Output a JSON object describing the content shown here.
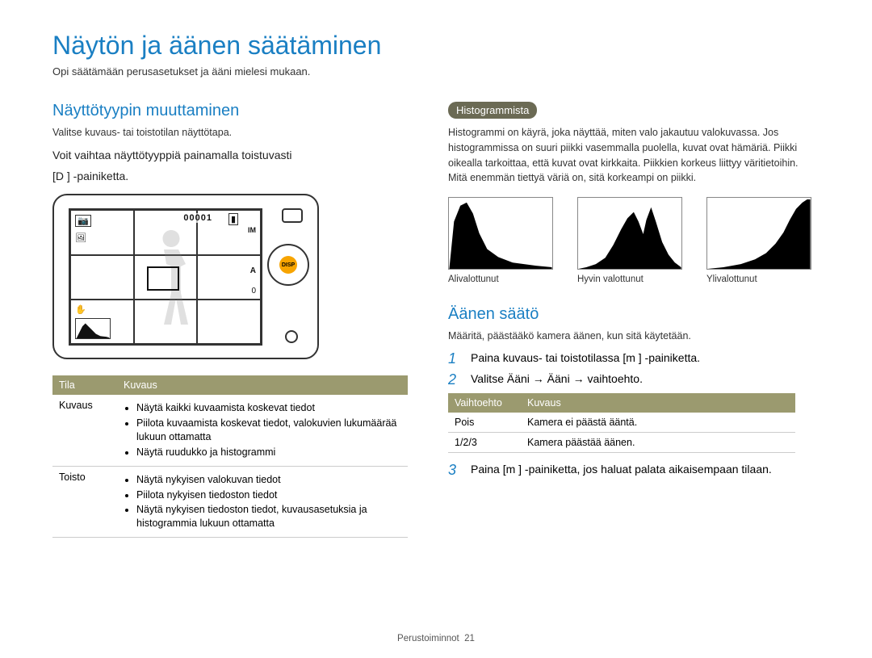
{
  "page_title": "Näytön ja äänen säätäminen",
  "page_subtitle": "Opi säätämään perusasetukset ja ääni mielesi mukaan.",
  "left": {
    "heading": "Näyttötyypin muuttaminen",
    "note": "Valitse kuvaus- tai toistotilan näyttötapa.",
    "body_line1": "Voit vaihtaa näyttötyyppiä painamalla toistuvasti",
    "body_line2": "[D   ] -painiketta.",
    "camera": {
      "counter": "00001",
      "disp": "DISP",
      "icons": {
        "topLeft": "📷",
        "indicator1": "IM",
        "indicator2": "A",
        "indicator3": "0"
      }
    },
    "table": {
      "headers": [
        "Tila",
        "Kuvaus"
      ],
      "rows": [
        {
          "mode": "Kuvaus",
          "items": [
            "Näytä kaikki kuvaamista koskevat tiedot",
            "Piilota kuvaamista koskevat tiedot, valokuvien lukumäärää lukuun ottamatta",
            "Näytä ruudukko ja histogrammi"
          ]
        },
        {
          "mode": "Toisto",
          "items": [
            "Näytä nykyisen valokuvan tiedot",
            "Piilota nykyisen tiedoston tiedot",
            "Näytä nykyisen tiedoston tiedot, kuvausasetuksia ja histogrammia lukuun ottamatta"
          ]
        }
      ]
    }
  },
  "right": {
    "tag": "Histogrammista",
    "hist_text": "Histogrammi on käyrä, joka näyttää, miten valo jakautuu valokuvassa. Jos histogrammissa on suuri piikki vasemmalla puolella, kuvat ovat hämäriä. Piikki oikealla tarkoittaa, että kuvat ovat kirkkaita. Piikkien korkeus liittyy väritietoihin. Mitä enemmän tiettyä väriä on, sitä korkeampi on piikki.",
    "hist_labels": [
      "Alivalottunut",
      "Hyvin valottunut",
      "Ylivalottunut"
    ],
    "sound_heading": "Äänen säätö",
    "sound_note": "Määritä, päästääkö kamera äänen, kun sitä käytetään.",
    "steps": [
      "Paina kuvaus- tai toistotilassa [m   ] -painiketta.",
      "Valitse Ääni → Ääni → vaihtoehto."
    ],
    "opt_table": {
      "headers": [
        "Vaihtoehto",
        "Kuvaus"
      ],
      "rows": [
        {
          "opt": "Pois",
          "desc": "Kamera ei päästä ääntä."
        },
        {
          "opt": "1/2/3",
          "desc": "Kamera päästää äänen."
        }
      ]
    },
    "step3": "Paina [m   ] -painiketta, jos haluat palata aikaisempaan tilaan."
  },
  "footer": {
    "section": "Perustoiminnot",
    "page": "21"
  }
}
